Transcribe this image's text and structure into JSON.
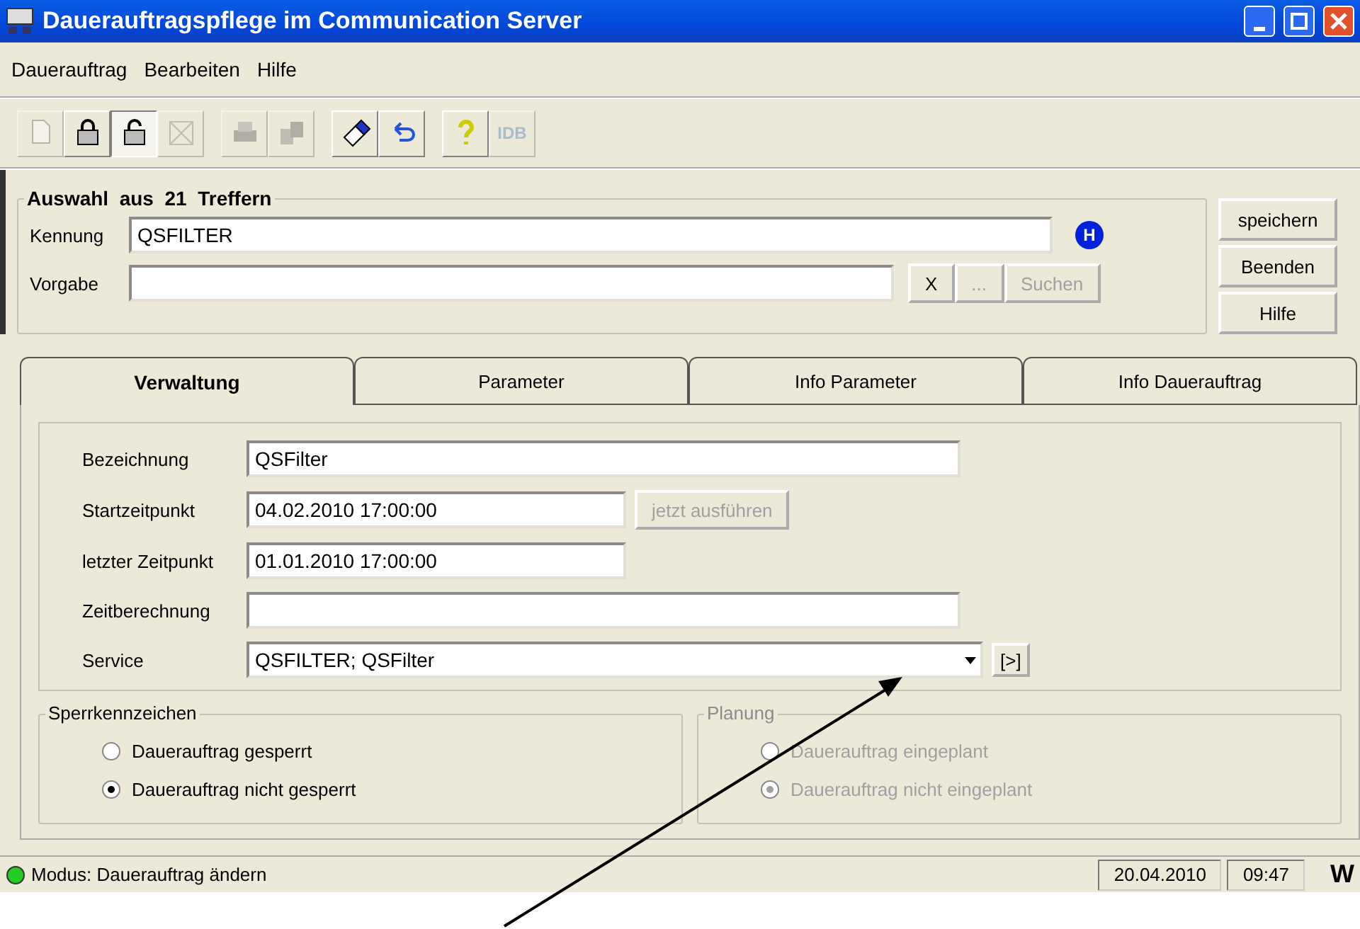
{
  "window": {
    "title": "Dauerauftragspflege im Communication Server"
  },
  "menu": [
    "Dauerauftrag",
    "Bearbeiten",
    "Hilfe"
  ],
  "toolbar": [
    [
      {
        "kind": "new",
        "disabled": true,
        "pressed": false
      },
      {
        "kind": "lock",
        "disabled": false,
        "pressed": false
      },
      {
        "kind": "unlock",
        "disabled": false,
        "pressed": true
      },
      {
        "kind": "delete",
        "disabled": true,
        "pressed": false
      }
    ],
    [
      {
        "kind": "print",
        "disabled": true,
        "pressed": false
      },
      {
        "kind": "copy",
        "disabled": true,
        "pressed": false
      }
    ],
    [
      {
        "kind": "eraser",
        "disabled": false,
        "pressed": false
      },
      {
        "kind": "undo",
        "disabled": false,
        "pressed": false
      }
    ],
    [
      {
        "kind": "help",
        "disabled": false,
        "pressed": false
      },
      {
        "kind": "idb",
        "label": "IDB",
        "disabled": true,
        "pressed": false
      }
    ]
  ],
  "selection": {
    "title": "Auswahl  aus  21  Treffern",
    "kennung": {
      "label": "Kennung",
      "value": "QSFILTER"
    },
    "badge": "H",
    "vorgabe": {
      "label": "Vorgabe"
    },
    "buttons": [
      {
        "label": "X",
        "disabled": false
      },
      {
        "label": "...",
        "disabled": true
      },
      {
        "label": "Suchen",
        "disabled": true
      }
    ]
  },
  "side_buttons": [
    "speichern",
    "Beenden",
    "Hilfe"
  ],
  "tabs": [
    {
      "label": "Verwaltung",
      "selected": true
    },
    {
      "label": "Parameter",
      "selected": false
    },
    {
      "label": "Info Parameter",
      "selected": false
    },
    {
      "label": "Info Dauerauftrag",
      "selected": false
    }
  ],
  "fields": [
    {
      "label": "Bezeichnung",
      "value": "QSFilter",
      "kind": "wide"
    },
    {
      "label": "Startzeitpunkt",
      "value": "04.02.2010 17:00:00",
      "kind": "action",
      "action": {
        "label": "jetzt ausführen",
        "disabled": true
      }
    },
    {
      "label": "letzter Zeitpunkt",
      "value": "01.01.2010 17:00:00",
      "kind": "short"
    },
    {
      "label": "Zeitberechnung",
      "kind": "wide"
    },
    {
      "label": "Service",
      "value": "QSFILTER; QSFilter",
      "kind": "combo",
      "action": {
        "label": "[>]",
        "disabled": false
      }
    }
  ],
  "groups": [
    {
      "title": "Sperrkennzeichen",
      "disabled": false,
      "options": [
        {
          "label": "Dauerauftrag gesperrt",
          "selected": false
        },
        {
          "label": "Dauerauftrag nicht gesperrt",
          "selected": true
        }
      ]
    },
    {
      "title": "Planung",
      "disabled": true,
      "options": [
        {
          "label": "Dauerauftrag eingeplant",
          "selected": false
        },
        {
          "label": "Dauerauftrag nicht eingeplant",
          "selected": true
        }
      ]
    }
  ],
  "status_bar": {
    "online": true,
    "text": "Modus: Dauerauftrag ändern",
    "date": "20.04.2010",
    "time": "09:47",
    "corner": "W"
  }
}
